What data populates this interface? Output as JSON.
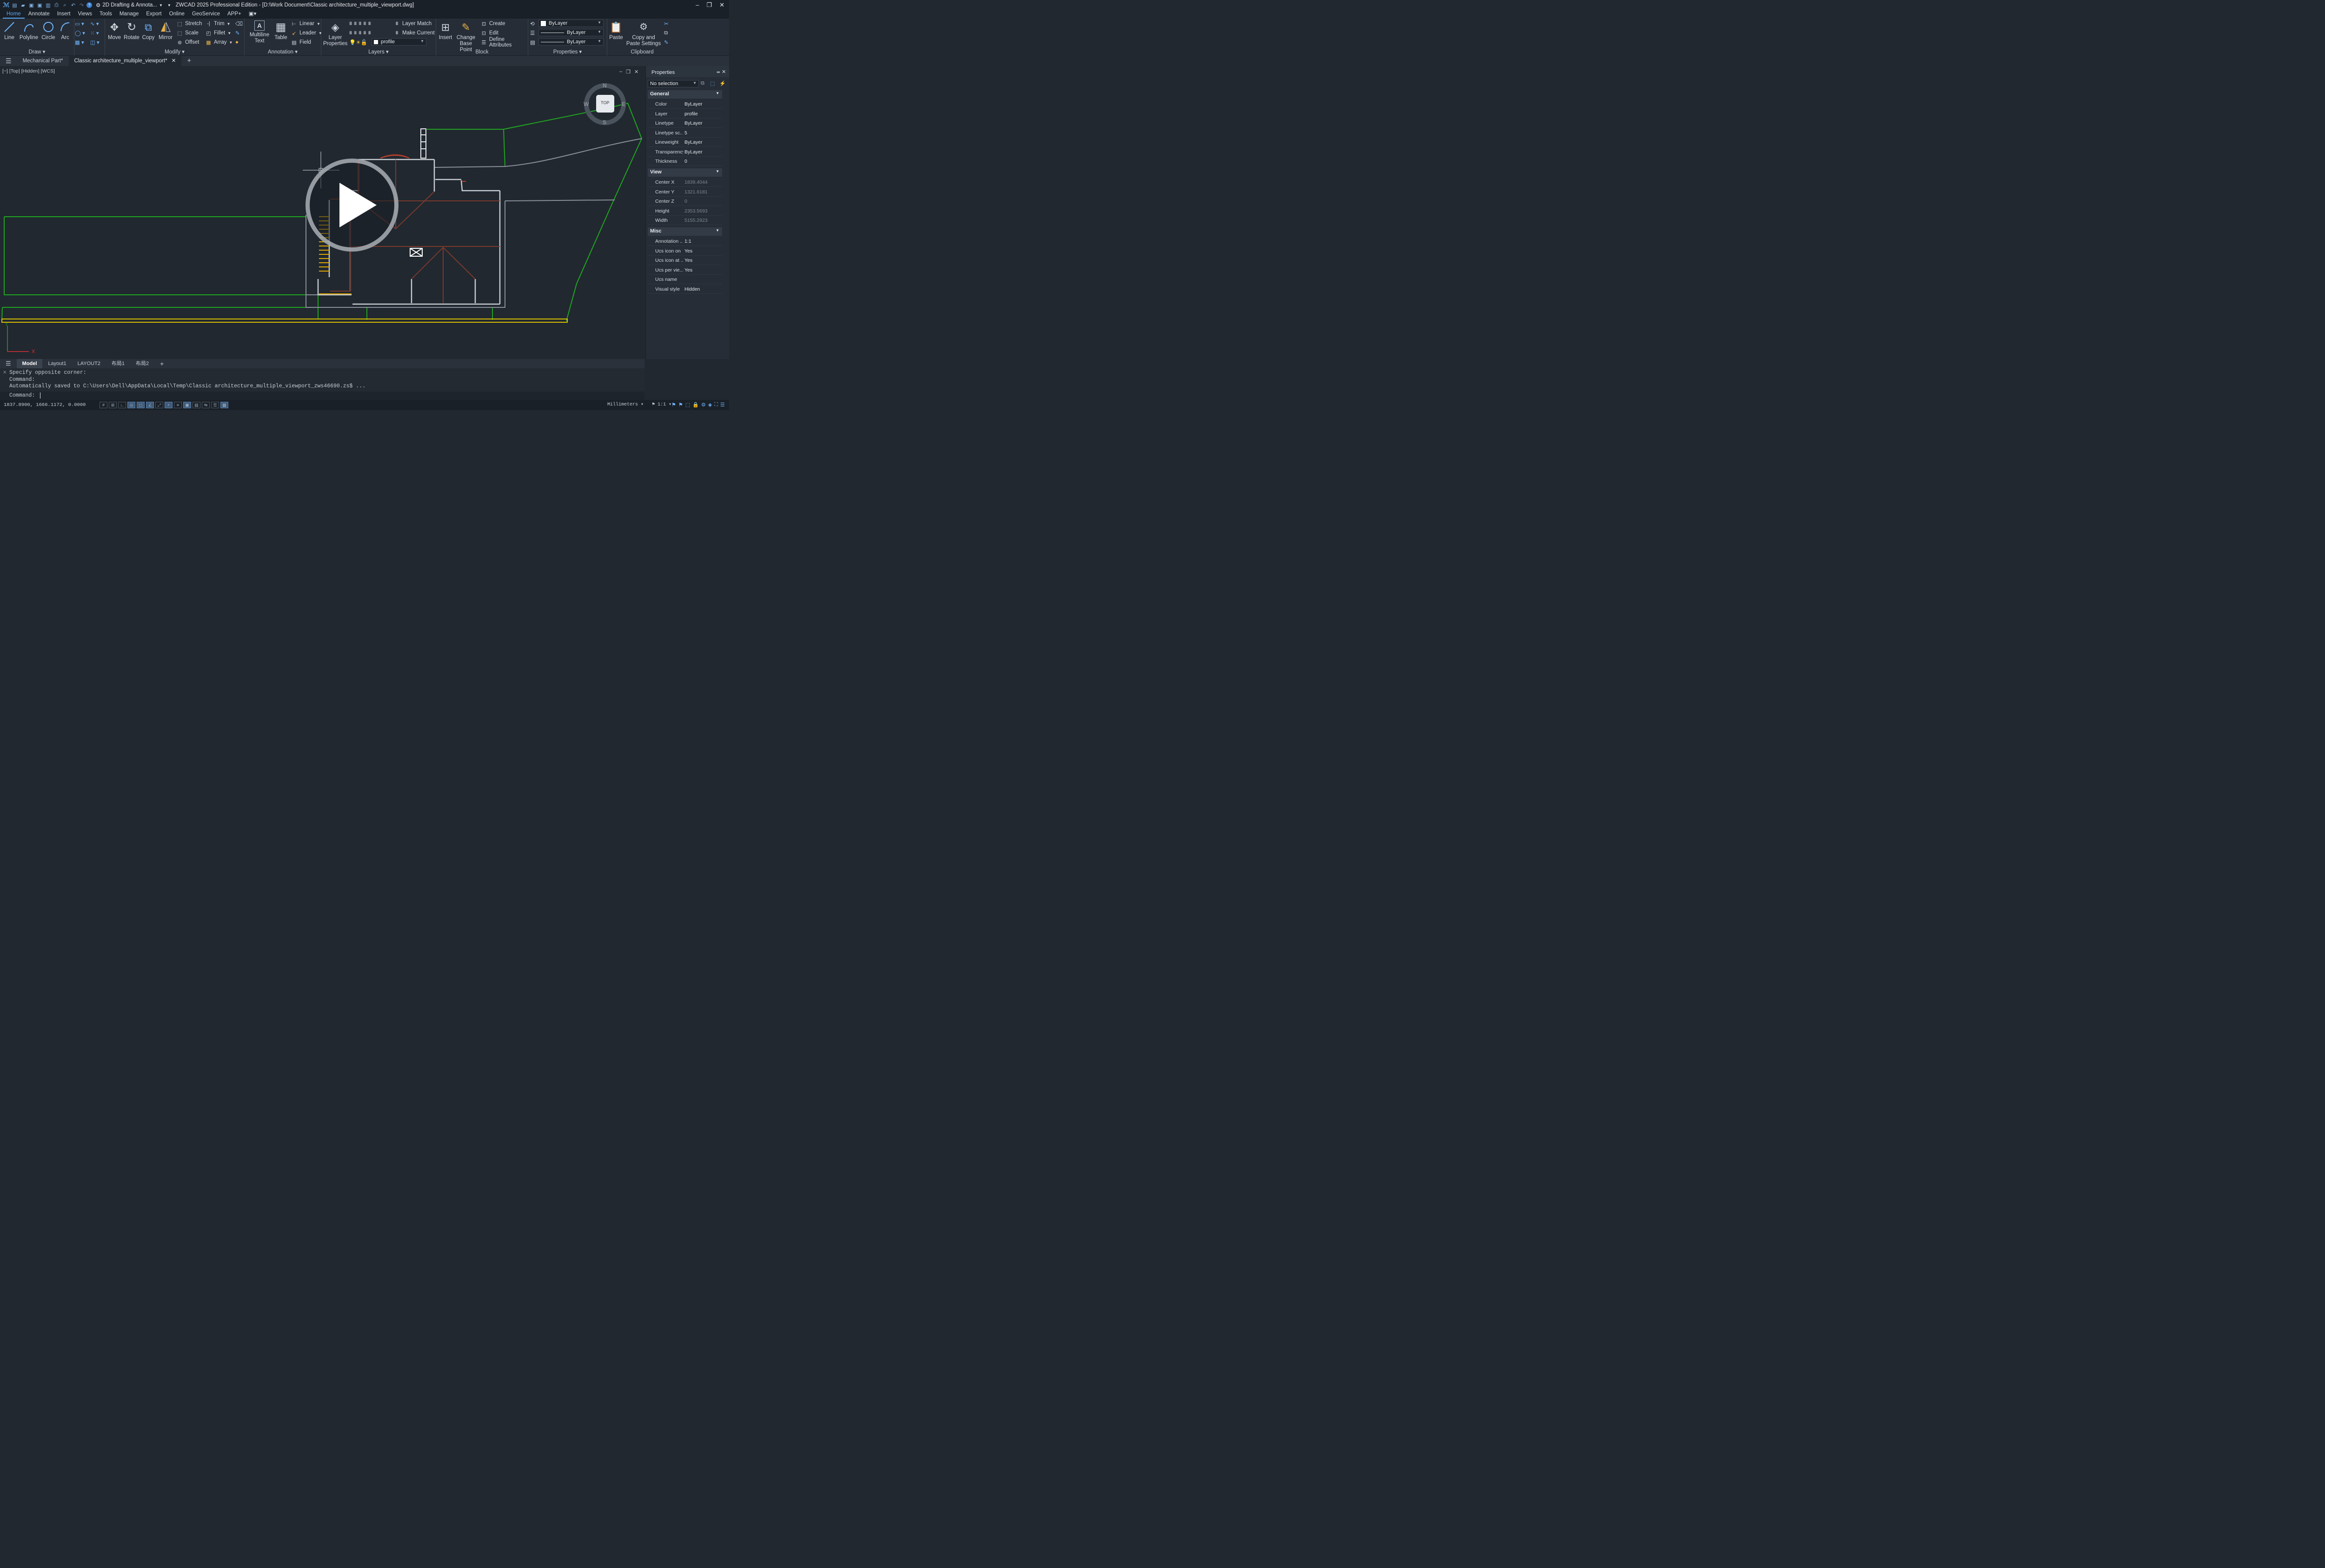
{
  "titlebar": {
    "workspace": "2D Drafting & Annota...",
    "title": "ZWCAD 2025 Professional Edition - [D:\\Work Document\\Classic architecture_multiple_viewport.dwg]"
  },
  "menubar": [
    "Home",
    "Annotate",
    "Insert",
    "Views",
    "Tools",
    "Manage",
    "Export",
    "Online",
    "GeoService",
    "APP+"
  ],
  "ribbon": {
    "draw": {
      "label": "Draw",
      "line": "Line",
      "polyline": "Polyline",
      "circle": "Circle",
      "arc": "Arc"
    },
    "modify": {
      "label": "Modify",
      "move": "Move",
      "rotate": "Rotate",
      "copy": "Copy",
      "mirror": "Mirror",
      "stretch": "Stretch",
      "scale": "Scale",
      "offset": "Offset",
      "trim": "Trim",
      "fillet": "Fillet",
      "array": "Array"
    },
    "annotation": {
      "label": "Annotation",
      "mtext": "Multiline Text",
      "table": "Table",
      "linear": "Linear",
      "leader": "Leader",
      "field": "Field"
    },
    "layers": {
      "label": "Layers",
      "props": "Layer Properties",
      "match": "Layer Match",
      "current": "Make Current",
      "layer_value": "profile"
    },
    "block": {
      "label": "Block",
      "insert": "Insert",
      "change": "Change Base Point",
      "create": "Create",
      "edit": "Edit",
      "define": "Define Attributes"
    },
    "properties": {
      "label": "Properties",
      "color": "ByLayer",
      "linetype": "ByLayer",
      "lineweight": "ByLayer"
    },
    "clipboard": {
      "label": "Clipboard",
      "paste": "Paste",
      "copypaste": "Copy and Paste Settings"
    }
  },
  "doctabs": [
    "Mechanical Part*",
    "Classic architecture_multiple_viewport*"
  ],
  "viewport": {
    "label": "[−] [Top] [Hidden] [WCS]",
    "cube_top": "TOP",
    "compass": {
      "n": "N",
      "s": "S",
      "e": "E",
      "w": "W"
    },
    "ucs_x": "X",
    "ucs_y": "Y"
  },
  "properties_panel": {
    "title": "Properties",
    "selection": "No selection",
    "general_label": "General",
    "view_label": "View",
    "misc_label": "Misc",
    "general": [
      [
        "Color",
        "ByLayer"
      ],
      [
        "Layer",
        "profile"
      ],
      [
        "Linetype",
        "ByLayer"
      ],
      [
        "Linetype sc...",
        "5"
      ],
      [
        "Lineweight",
        "ByLayer"
      ],
      [
        "Transparency",
        "ByLayer"
      ],
      [
        "Thickness",
        "0"
      ]
    ],
    "view": [
      [
        "Center X",
        "1839.4044"
      ],
      [
        "Center Y",
        "1321.6181"
      ],
      [
        "Center Z",
        "0"
      ],
      [
        "Height",
        "2353.5693"
      ],
      [
        "Width",
        "5155.2923"
      ]
    ],
    "misc": [
      [
        "Annotation ...",
        "1:1"
      ],
      [
        "Ucs icon on",
        "Yes"
      ],
      [
        "Ucs icon at ...",
        "Yes"
      ],
      [
        "Ucs per vie...",
        "Yes"
      ],
      [
        "Ucs name",
        ""
      ],
      [
        "Visual style",
        "Hidden"
      ]
    ]
  },
  "layouttabs": [
    "Model",
    "Layout1",
    "LAYOUT2",
    "布局1",
    "布局2"
  ],
  "command": {
    "history": [
      "Specify opposite corner:",
      "Command:",
      "Automatically saved to C:\\Users\\Dell\\AppData\\Local\\Temp\\Classic architecture_multiple_viewport_zws46690.zs$ ..."
    ],
    "prompt": "Command:"
  },
  "status": {
    "coords": "1837.8900,  1666.1172,  0.0000",
    "units": "Millimeters",
    "scale": "1:1"
  },
  "colors": {
    "bg": "#212830",
    "green": "#1fa51f",
    "grey": "#8a9099",
    "brown": "#7a3a2c",
    "yellow": "#e0c000"
  }
}
